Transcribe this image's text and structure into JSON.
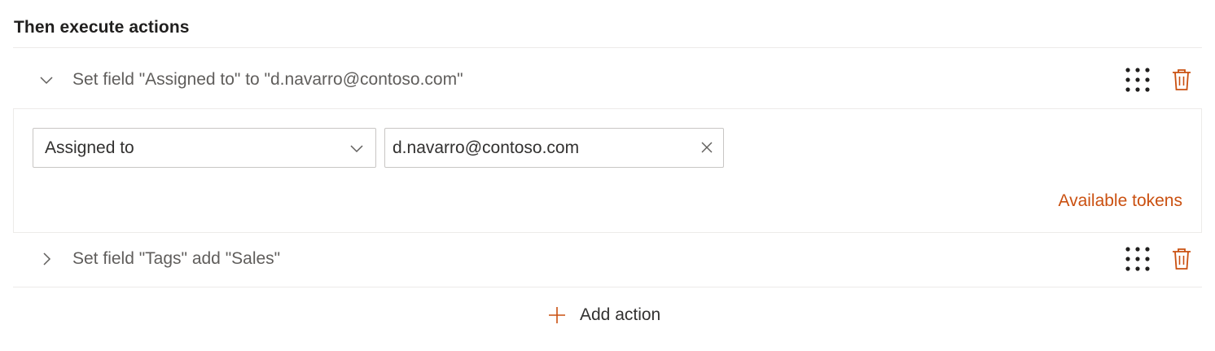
{
  "section": {
    "title": "Then execute actions"
  },
  "actions": [
    {
      "title": "Set field \"Assigned to\" to \"d.navarro@contoso.com\"",
      "expanded": true,
      "chevron_icon": "chevron-down-icon",
      "drag_icon": "drag-handle-icon",
      "delete_icon": "trash-icon"
    },
    {
      "title": "Set field \"Tags\" add \"Sales\"",
      "expanded": false,
      "chevron_icon": "chevron-right-icon",
      "drag_icon": "drag-handle-icon",
      "delete_icon": "trash-icon"
    }
  ],
  "editor": {
    "field_select_value": "Assigned to",
    "field_value": "d.navarro@contoso.com",
    "tokens_link": "Available tokens"
  },
  "footer": {
    "add_action_label": "Add action"
  },
  "colors": {
    "accent": "#ca5010",
    "text": "#323130",
    "muted_text": "#605e5c",
    "border": "#c8c6c4",
    "divider": "#edebe9"
  }
}
